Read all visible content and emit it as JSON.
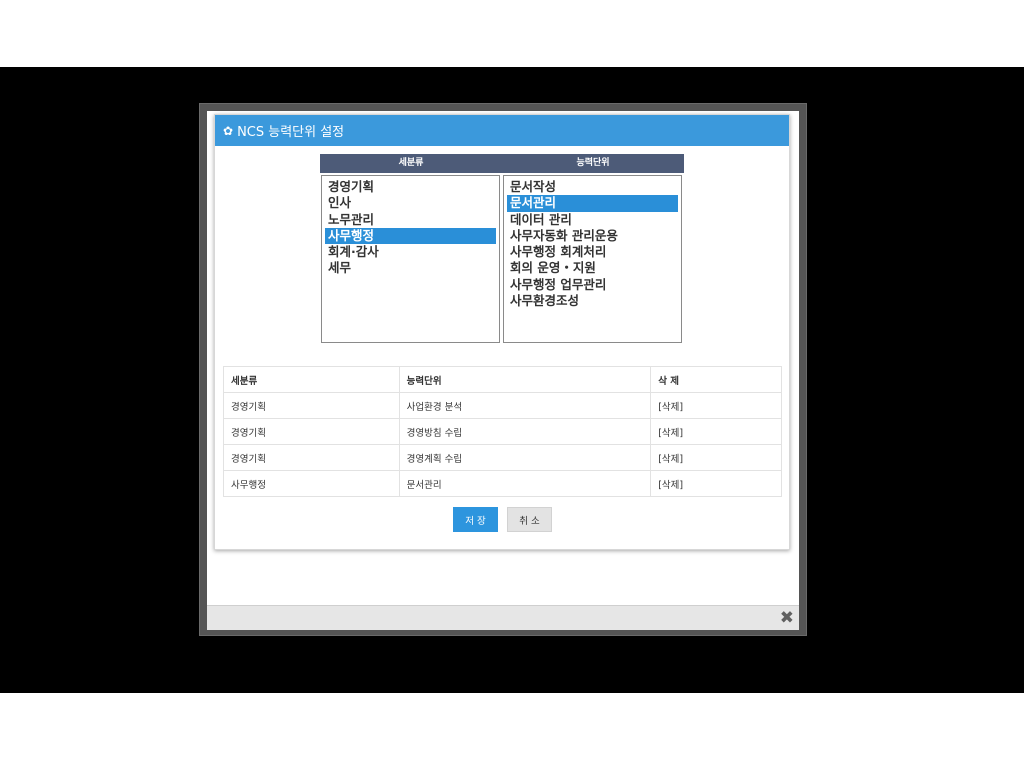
{
  "dialog": {
    "title": "NCS 능력단위 설정",
    "gear_icon": "✿"
  },
  "lists": {
    "headers": [
      "세분류",
      "능력단위"
    ],
    "left_options": [
      "경영기획",
      "인사",
      "노무관리",
      "사무행정",
      "회계·감사",
      "세무"
    ],
    "left_selected": "사무행정",
    "right_options": [
      "문서작성",
      "문서관리",
      "데이터 관리",
      "사무자동화 관리운용",
      "사무행정 회계처리",
      "회의 운영・지원",
      "사무행정 업무관리",
      "사무환경조성"
    ],
    "right_selected": "문서관리"
  },
  "table": {
    "headers": [
      "세분류",
      "능력단위",
      "삭 제"
    ],
    "rows": [
      [
        "경영기획",
        "사업환경 분석",
        "[삭제]"
      ],
      [
        "경영기획",
        "경영방침 수립",
        "[삭제]"
      ],
      [
        "경영기획",
        "경영계획 수립",
        "[삭제]"
      ],
      [
        "사무행정",
        "문서관리",
        "[삭제]"
      ]
    ]
  },
  "buttons": {
    "save": "저 장",
    "cancel": "취 소"
  },
  "footer": {
    "close_icon": "✖"
  },
  "colors": {
    "header": "#3b99dc",
    "column_header": "#4d5b78",
    "selected": "#2a8fd8",
    "save_button": "#2d95de"
  }
}
